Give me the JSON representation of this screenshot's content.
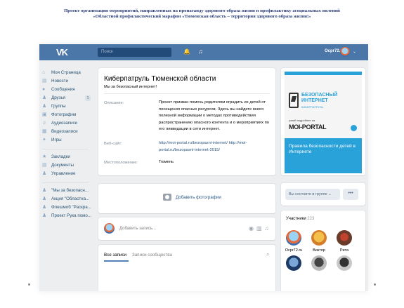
{
  "slide": {
    "title_line1": "Проект организации мероприятий, направленных на пропаганду здорового образа жизни и профилактику асоциальных явлений",
    "title_line2": "«Областной профилактический марафон «Тюменская область – территория здорового образа жизни!»"
  },
  "topbar": {
    "logo": "VK",
    "search_placeholder": "Поиск",
    "user_name": "Ocpr72.ru"
  },
  "sidebar": {
    "items": [
      {
        "label": "Моя Страница",
        "icon": "home-icon"
      },
      {
        "label": "Новости",
        "icon": "news-icon"
      },
      {
        "label": "Сообщения",
        "icon": "messages-icon"
      },
      {
        "label": "Друзья",
        "icon": "friends-icon",
        "count": "1"
      },
      {
        "label": "Группы",
        "icon": "groups-icon"
      },
      {
        "label": "Фотографии",
        "icon": "photos-icon"
      },
      {
        "label": "Аудиозаписи",
        "icon": "audio-icon"
      },
      {
        "label": "Видеозаписи",
        "icon": "video-icon"
      },
      {
        "label": "Игры",
        "icon": "games-icon"
      }
    ],
    "items2": [
      {
        "label": "Закладки",
        "icon": "bookmarks-icon"
      },
      {
        "label": "Документы",
        "icon": "documents-icon"
      },
      {
        "label": "Управление",
        "icon": "manage-icon"
      }
    ],
    "groups": [
      {
        "label": "\"Мы за безопасн..."
      },
      {
        "label": "Акция \"Областна..."
      },
      {
        "label": "Флешмоб \"Раскра..."
      },
      {
        "label": "Проект Рука помо..."
      }
    ]
  },
  "profile": {
    "title": "Киберпатруль Тюменской области",
    "status": "Мы за безопасный интернет!",
    "description_label": "Описание:",
    "description": "Проект призван помочь родителям оградить их детей от посещения опасных ресурсов. Здесь вы найдете много полезной информации о методах противодействия распространению опасного контента и о мероприятиях по его ликвидации в сети интернет.",
    "website_label": "Веб-сайт:",
    "website": "http://moi-portal.ru/bezopasni-internet/ http://moi-portal.ru/bezopasni-internet-2015/",
    "location_label": "Местоположение:",
    "location": "Тюмень"
  },
  "photos": {
    "add_label": "Добавить фотографии"
  },
  "post": {
    "placeholder": "Добавить запись..."
  },
  "wall": {
    "tab_all": "Все записи",
    "tab_community": "Записи сообщества"
  },
  "cover": {
    "title": "БЕЗОПАСНЫЙ ИНТЕРНЕТ",
    "subtitle": "КИБЕРПАТРУЛЬ",
    "note": "узнай подробнее на",
    "portal": "MOI-PORTAL",
    "caption": "Правила безопасности детей в Интернете"
  },
  "membership": {
    "button": "Вы состоите в группе ⌄",
    "more": "•••"
  },
  "members": {
    "title": "Участники",
    "count": "223",
    "names": [
      "Ocpr72.ru",
      "Виктор",
      "Рита"
    ]
  },
  "colors": {
    "vk_blue": "#4a76a8",
    "accent_cyan": "#29a1d9",
    "link": "#2a5885"
  }
}
